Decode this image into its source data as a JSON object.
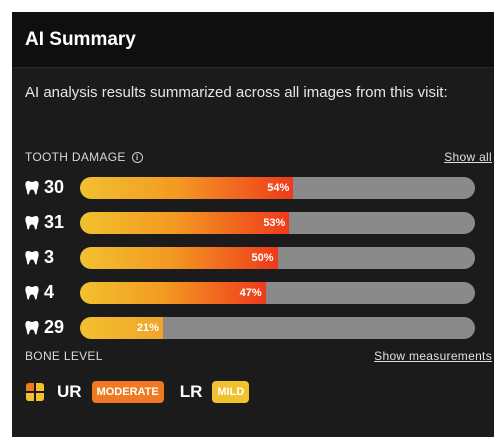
{
  "summary": {
    "title": "AI Summary",
    "description": "AI analysis results summarized across all images from this visit:"
  },
  "tooth_damage": {
    "label": "TOOTH DAMAGE",
    "info_glyph": "i",
    "show_all": "Show all",
    "colors": {
      "fill_start": "#f2c12e",
      "fill_end": "#ee3a1c",
      "track": "#8a8a8a"
    },
    "rows": [
      {
        "tooth": "30",
        "percent": 54,
        "percent_label": "54%"
      },
      {
        "tooth": "31",
        "percent": 53,
        "percent_label": "53%"
      },
      {
        "tooth": "3",
        "percent": 50,
        "percent_label": "50%"
      },
      {
        "tooth": "4",
        "percent": 47,
        "percent_label": "47%"
      },
      {
        "tooth": "29",
        "percent": 21,
        "percent_label": "21%"
      }
    ]
  },
  "bone_level": {
    "label": "BONE LEVEL",
    "show_measurements": "Show measurements",
    "regions": [
      {
        "region": "UR",
        "severity": "MODERATE",
        "color": "#f07a22"
      },
      {
        "region": "LR",
        "severity": "MILD",
        "color": "#f2c12e"
      }
    ]
  }
}
